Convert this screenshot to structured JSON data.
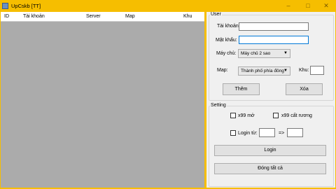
{
  "window": {
    "title": "UpCskb [TT]",
    "minimize_icon": "minimize-icon",
    "maximize_icon": "maximize-icon",
    "close_icon": "close-icon",
    "frame_color": "#f6be00"
  },
  "grid": {
    "columns": [
      "ID",
      "Tài khoản",
      "Server",
      "Map",
      "Khu"
    ]
  },
  "user": {
    "legend": "User",
    "account_label": "Tài khoản:",
    "account_value": "",
    "password_label": "Mật khẩu:",
    "password_value": "",
    "server_label": "Máy chủ:",
    "server_selected": "Máy chủ 2 sao",
    "map_label": "Map:",
    "map_selected": "Thành phố phía đông",
    "zone_label": "Khu:",
    "zone_value": "",
    "add_button": "Thêm",
    "delete_button": "Xóa"
  },
  "setting": {
    "legend": "Setting",
    "x99_mo_label": "x99 mở",
    "x99_cat_ruong_label": "x99 cất rương",
    "login_from_label": "Login từ:",
    "login_from_value": "",
    "arrow_text": "=>",
    "login_to_value": "",
    "login_button": "Login",
    "close_all_button": "Đóng tất cả"
  }
}
